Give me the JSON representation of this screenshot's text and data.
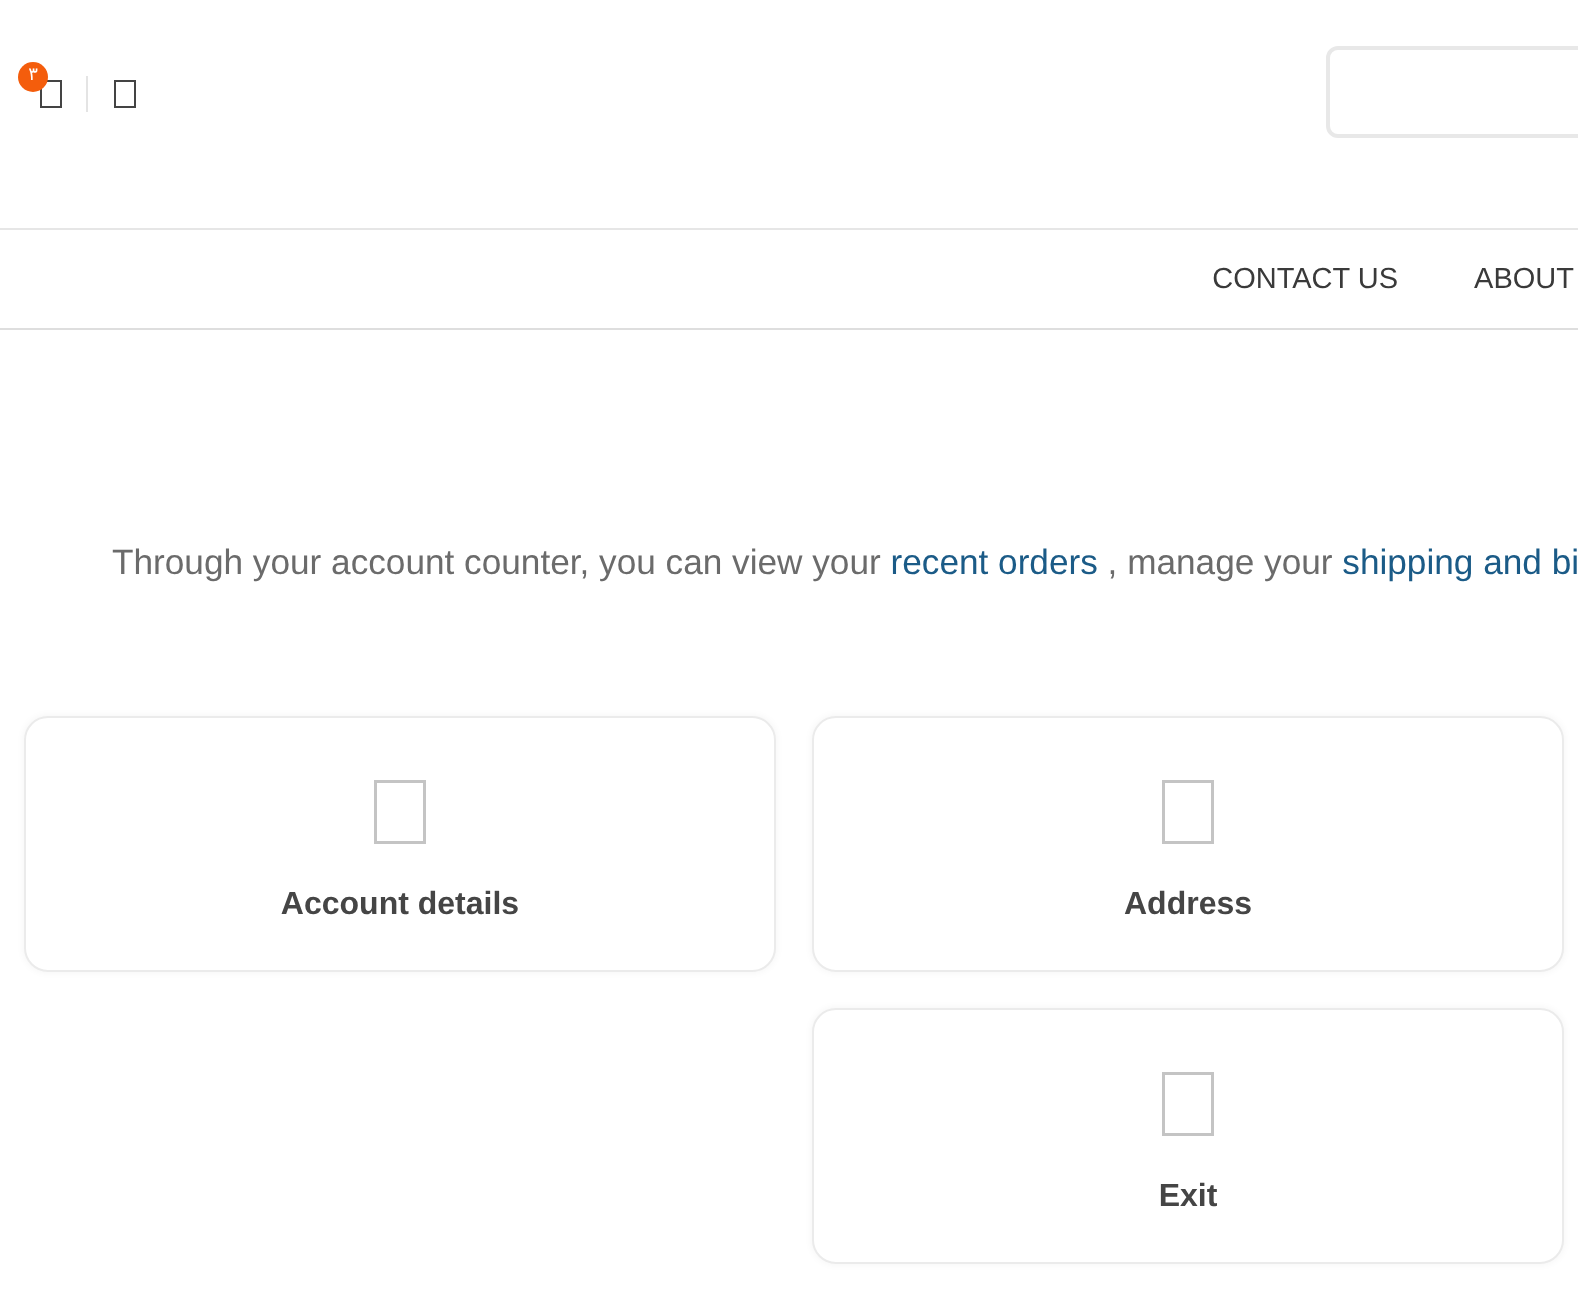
{
  "header": {
    "cart": {
      "badge": "۳"
    }
  },
  "nav": {
    "items": [
      {
        "label": "CONTACT US"
      },
      {
        "label": "ABOUT"
      }
    ]
  },
  "intro": {
    "parts": [
      {
        "kind": "text",
        "text": "Through your account counter, you can view your "
      },
      {
        "kind": "link",
        "text": "recent orders"
      },
      {
        "kind": "text",
        "text": " , manage your "
      },
      {
        "kind": "link",
        "text": "shipping and bi"
      }
    ]
  },
  "cards": [
    {
      "label": "Account details"
    },
    {
      "label": "Address"
    },
    {
      "label": "Exit"
    }
  ]
}
